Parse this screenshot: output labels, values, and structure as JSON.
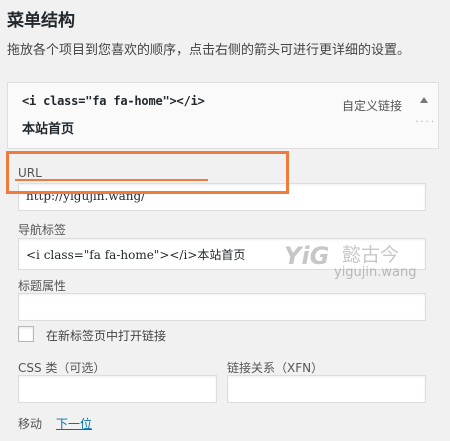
{
  "section": {
    "title": "菜单结构",
    "description": "拖放各个项目到您喜欢的顺序，点击右侧的箭头可进行更详细的设置。"
  },
  "menu_item": {
    "title_code": "<i class=\"fa fa-home\"></i>",
    "title_text": "本站首页",
    "type": "自定义链接"
  },
  "fields": {
    "url_label": "URL",
    "url_value": "http://yigujin.wang/",
    "nav_label": "导航标签",
    "nav_value": "<i class=\"fa fa-home\"></i>本站首页",
    "title_attr_label": "标题属性",
    "title_attr_value": "",
    "new_tab_label": "在新标签页中打开链接",
    "css_label": "CSS 类（可选）",
    "css_value": "",
    "xfn_label": "链接关系（XFN）",
    "xfn_value": ""
  },
  "move": {
    "label": "移动",
    "link": "下一位"
  },
  "watermark": {
    "logo": "YiG",
    "text": "懿古今",
    "url": "yigujin.wang"
  },
  "colors": {
    "highlight": "#f07b3d",
    "link": "#0073aa"
  }
}
